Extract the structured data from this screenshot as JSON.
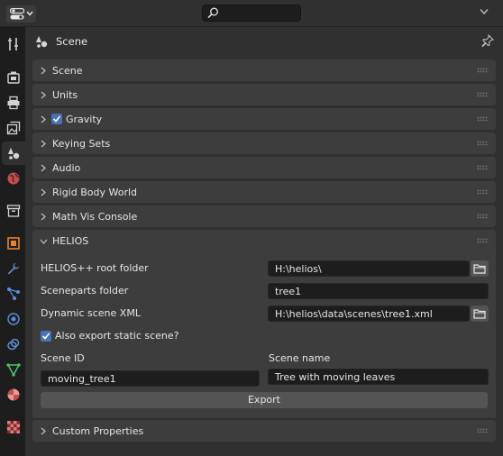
{
  "header": {
    "search": {
      "value": "",
      "placeholder": ""
    }
  },
  "context": {
    "title": "Scene"
  },
  "sections": [
    {
      "label": "Scene",
      "expanded": false
    },
    {
      "label": "Units",
      "expanded": false
    },
    {
      "label": "Gravity",
      "expanded": false,
      "checked": true
    },
    {
      "label": "Keying Sets",
      "expanded": false
    },
    {
      "label": "Audio",
      "expanded": false
    },
    {
      "label": "Rigid Body World",
      "expanded": false
    },
    {
      "label": "Math Vis Console",
      "expanded": false
    },
    {
      "label": "HELIOS",
      "expanded": true
    },
    {
      "label": "Custom Properties",
      "expanded": false
    }
  ],
  "helios": {
    "root_folder_label": "HELIOS++ root folder",
    "root_folder_value": "H:\\helios\\",
    "sceneparts_label": "Sceneparts folder",
    "sceneparts_value": "tree1",
    "scene_xml_label": "Dynamic scene XML",
    "scene_xml_value": "H:\\helios\\data\\scenes\\tree1.xml",
    "export_static_label": "Also export static scene?",
    "export_static_checked": true,
    "scene_id_label": "Scene ID",
    "scene_id_value": "moving_tree1",
    "scene_name_label": "Scene name",
    "scene_name_value": "Tree with moving leaves",
    "export_label": "Export"
  },
  "tabs": [
    {
      "name": "tool-tab",
      "icon": "tool-icon"
    },
    {
      "name": "render-tab",
      "icon": "camera-back-icon"
    },
    {
      "name": "output-tab",
      "icon": "printer-icon"
    },
    {
      "name": "view-layer-tab",
      "icon": "image-stack-icon"
    },
    {
      "name": "scene-tab",
      "icon": "scene-icon",
      "active": true
    },
    {
      "name": "world-tab",
      "icon": "world-icon"
    },
    {
      "name": "collection-tab",
      "icon": "collection-box-icon"
    },
    {
      "name": "object-tab",
      "icon": "object-square-icon"
    },
    {
      "name": "modifiers-tab",
      "icon": "wrench-icon"
    },
    {
      "name": "particles-tab",
      "icon": "particles-icon"
    },
    {
      "name": "physics-tab",
      "icon": "physics-orbit-icon"
    },
    {
      "name": "constraints-tab",
      "icon": "constraint-icon"
    },
    {
      "name": "data-tab",
      "icon": "mesh-data-icon"
    },
    {
      "name": "material-tab",
      "icon": "material-sphere-icon"
    },
    {
      "name": "texture-tab",
      "icon": "checker-texture-icon"
    }
  ],
  "colors": {
    "accent": "#4772b3",
    "panel": "#3d3d3d",
    "field": "#1d1d1d"
  }
}
